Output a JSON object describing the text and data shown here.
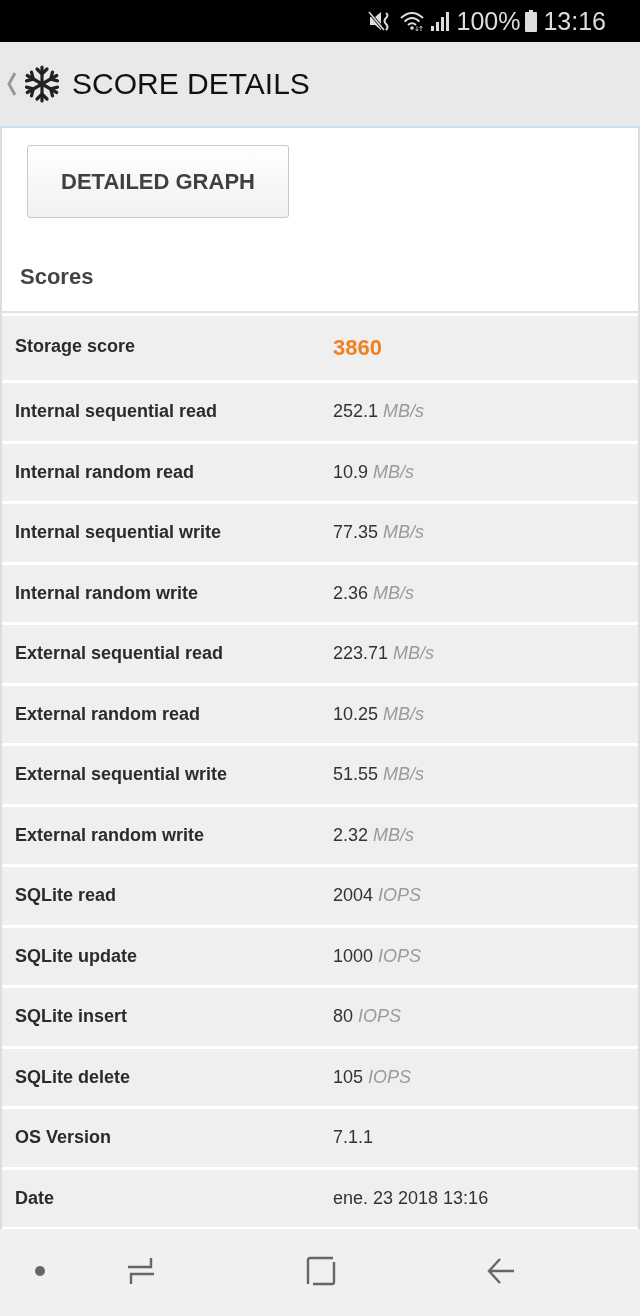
{
  "status_bar": {
    "battery": "100%",
    "time": "13:16"
  },
  "title_bar": {
    "title": "SCORE DETAILS"
  },
  "button": {
    "label": "DETAILED GRAPH"
  },
  "section": {
    "title": "Scores"
  },
  "rows": [
    {
      "kind": "score",
      "label": "Storage score",
      "value": "3860"
    },
    {
      "kind": "value",
      "label": "Internal sequential read",
      "value": "252.1",
      "unit": "MB/s"
    },
    {
      "kind": "value",
      "label": "Internal random read",
      "value": "10.9",
      "unit": "MB/s"
    },
    {
      "kind": "value",
      "label": "Internal sequential write",
      "value": "77.35",
      "unit": "MB/s"
    },
    {
      "kind": "value",
      "label": "Internal random write",
      "value": "2.36",
      "unit": "MB/s"
    },
    {
      "kind": "value",
      "label": "External sequential read",
      "value": "223.71",
      "unit": "MB/s"
    },
    {
      "kind": "value",
      "label": "External random read",
      "value": "10.25",
      "unit": "MB/s"
    },
    {
      "kind": "value",
      "label": "External sequential write",
      "value": "51.55",
      "unit": "MB/s"
    },
    {
      "kind": "value",
      "label": "External random write",
      "value": "2.32",
      "unit": "MB/s"
    },
    {
      "kind": "value",
      "label": "SQLite read",
      "value": "2004",
      "unit": "IOPS"
    },
    {
      "kind": "value",
      "label": "SQLite update",
      "value": "1000",
      "unit": "IOPS"
    },
    {
      "kind": "value",
      "label": "SQLite insert",
      "value": "80",
      "unit": "IOPS"
    },
    {
      "kind": "value",
      "label": "SQLite delete",
      "value": "105",
      "unit": "IOPS"
    },
    {
      "kind": "value",
      "label": "OS Version",
      "value": "7.1.1"
    },
    {
      "kind": "value",
      "label": "Date",
      "value": "ene. 23 2018 13:16"
    }
  ]
}
